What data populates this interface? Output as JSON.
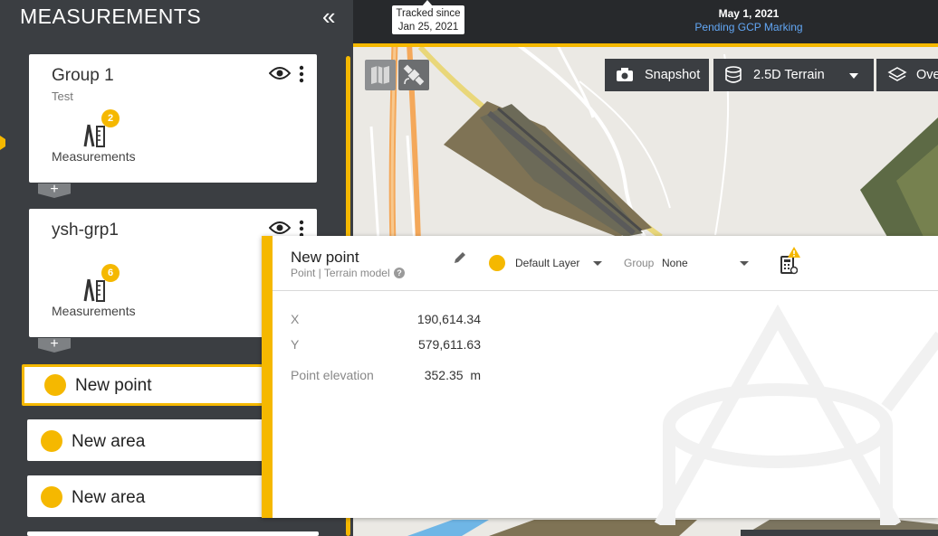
{
  "sidebar": {
    "title": "MEASUREMENTS",
    "collapse_glyph": "«",
    "groups": [
      {
        "title": "Group 1",
        "subtitle": "Test",
        "badge": "2",
        "label": "Measurements"
      },
      {
        "title": "ysh-grp1",
        "subtitle": "",
        "badge": "6",
        "label": "Measurements"
      }
    ],
    "add_glyph": "+",
    "items": [
      {
        "label": "New point"
      },
      {
        "label": "New area"
      },
      {
        "label": "New area"
      }
    ]
  },
  "header": {
    "tracked_line1": "Tracked since",
    "tracked_line2": "Jan 25, 2021",
    "date": "May 1, 2021",
    "status": "Pending GCP Marking"
  },
  "toolbar": {
    "snapshot": "Snapshot",
    "terrain": "2.5D Terrain",
    "overlays": "Ove"
  },
  "panel": {
    "title": "New point",
    "subtitle": "Point | Terrain model",
    "help": "?",
    "layer": "Default Layer",
    "group_label": "Group",
    "group_value": "None",
    "fields": [
      {
        "label": "X",
        "value": "190,614.34"
      },
      {
        "label": "Y",
        "value": "579,611.63"
      },
      {
        "label": "Point elevation",
        "value": "352.35  m"
      }
    ]
  },
  "colors": {
    "accent": "#f5b800",
    "sidebar": "#3b3e42",
    "link": "#62a7f5"
  }
}
